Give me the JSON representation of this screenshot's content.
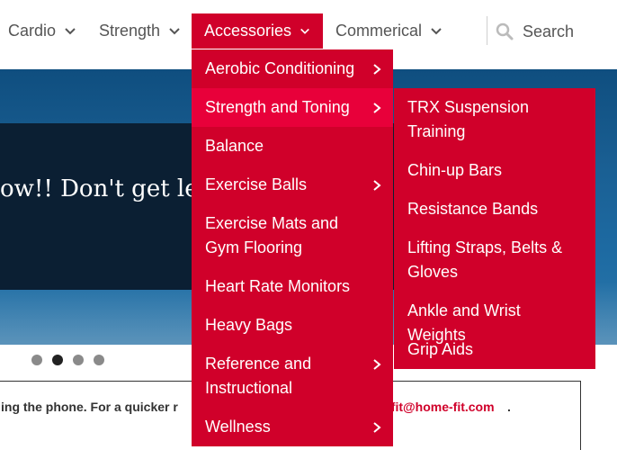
{
  "nav": {
    "items": [
      {
        "label": "Cardio"
      },
      {
        "label": "Strength"
      },
      {
        "label": "Accessories"
      },
      {
        "label": "Commerical"
      }
    ],
    "search_placeholder": "Search"
  },
  "hero": {
    "text": "ow!! Don't get lef",
    "slides_total": 4,
    "active_slide": 2
  },
  "notice": {
    "text": "ing the phone.  For a quicker r",
    "email": "cfit@home-fit.com",
    "trailing": "."
  },
  "accessories_menu": {
    "items": [
      {
        "label": "Aerobic Conditioning",
        "has_submenu": true
      },
      {
        "label": "Strength and Toning",
        "has_submenu": true,
        "highlighted": true
      },
      {
        "label": "Balance",
        "has_submenu": false
      },
      {
        "label": "Exercise Balls",
        "has_submenu": true
      },
      {
        "label": "Exercise Mats and Gym Flooring",
        "has_submenu": false
      },
      {
        "label": "Heart Rate Monitors",
        "has_submenu": false
      },
      {
        "label": "Heavy Bags",
        "has_submenu": false
      },
      {
        "label": "Reference and Instructional",
        "has_submenu": true
      },
      {
        "label": "Wellness",
        "has_submenu": true
      }
    ]
  },
  "strength_submenu": {
    "items": [
      {
        "label": "TRX Suspension Training"
      },
      {
        "label": "Chin-up Bars"
      },
      {
        "label": "Resistance Bands"
      },
      {
        "label": "Lifting Straps, Belts & Gloves"
      },
      {
        "label": "Ankle and Wrist Weights"
      },
      {
        "label": "Grip Aids"
      }
    ]
  },
  "colors": {
    "accent": "#d0002a",
    "accent_highlight": "#e8003a",
    "nav_text": "#555555"
  },
  "icons": {
    "nav_chevron": "chevron-down-icon",
    "submenu_arrow": "chevron-right-icon",
    "search": "search-icon"
  }
}
